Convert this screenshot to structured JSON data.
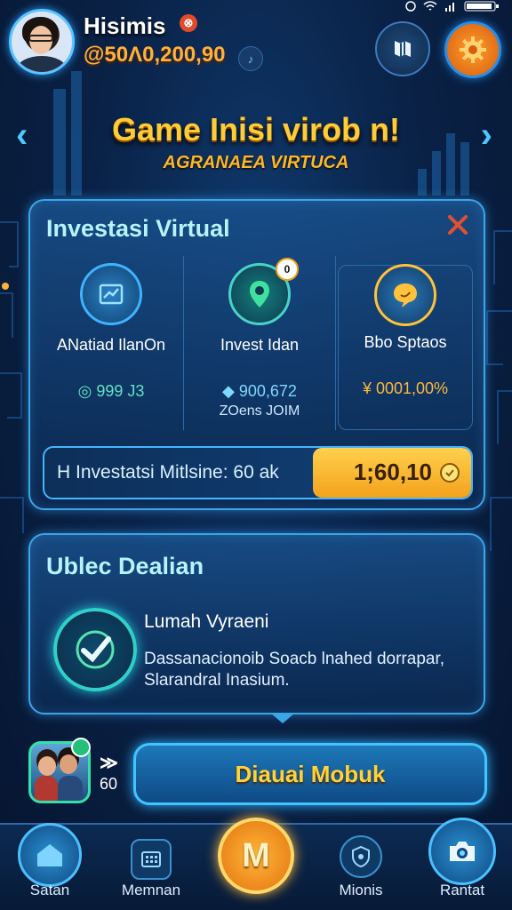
{
  "status_bar": {
    "time": ""
  },
  "header": {
    "player_name": "Hisimis",
    "name_badge": "⊗",
    "currency_amount": "@50Λ0,200,90",
    "currency_icon_glyph": "♪"
  },
  "title": {
    "main": "Game Inisi virob n!",
    "subtitle": "AGRANAEA VIRTUCA"
  },
  "invest_panel": {
    "title": "Investasi Virtual",
    "options": [
      {
        "label": "ANatiad IlanOn",
        "value": "◎ 999 J3",
        "sub": "",
        "icon": "chart-icon"
      },
      {
        "label": "Invest Idan",
        "value": "◆ 900,672",
        "sub": "ZOens JOIM",
        "badge": "0",
        "icon": "location-pin-icon"
      },
      {
        "label": "Bbo Sptaos",
        "value": "¥ 0001,00%",
        "sub": "",
        "icon": "chat-bubble-icon"
      }
    ],
    "progress_label": "H Investatsi Mitlsine: 60 ak",
    "progress_amount": "1;60,10"
  },
  "update_panel": {
    "title": "Ublec Dealian",
    "heading": "Lumah Vyraeni",
    "description": "Dassanacionoib Soacb lnahed dorrapar, Slarandral Inasium."
  },
  "friends": {
    "arrow": "≫",
    "count": "60"
  },
  "play_button": {
    "label": "Diauai Mobuk"
  },
  "bottom_nav": {
    "home": "Satan",
    "menu": "Memnan",
    "center_glyph": "M",
    "missions": "Mionis",
    "camera": "Rantat"
  },
  "colors": {
    "accent_blue": "#3aa6e8",
    "gold": "#ffcc38",
    "background": "#0a2247"
  }
}
